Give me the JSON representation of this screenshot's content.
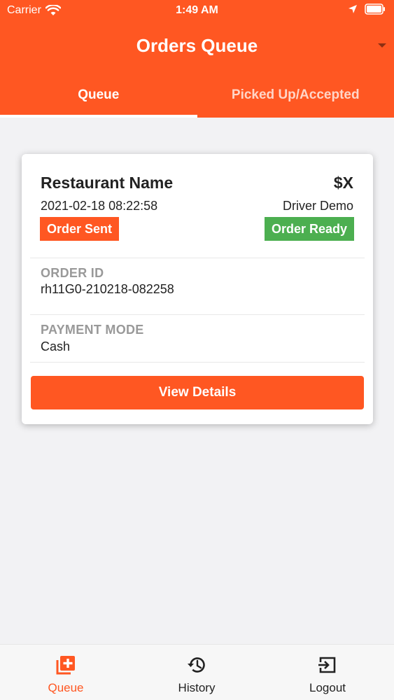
{
  "status": {
    "carrier": "Carrier",
    "time": "1:49 AM"
  },
  "header": {
    "title": "Orders Queue"
  },
  "tabs": [
    {
      "label": "Queue",
      "active": true
    },
    {
      "label": "Picked Up/Accepted",
      "active": false
    }
  ],
  "order": {
    "restaurant": "Restaurant Name",
    "price": "$X",
    "datetime": "2021-02-18 08:22:58",
    "driver": "Driver Demo",
    "status_sent": "Order Sent",
    "status_ready": "Order Ready",
    "order_id_label": "ORDER ID",
    "order_id": "rh11G0-210218-082258",
    "payment_label": "PAYMENT MODE",
    "payment": "Cash",
    "view_details": "View Details"
  },
  "nav": {
    "queue": "Queue",
    "history": "History",
    "logout": "Logout"
  },
  "colors": {
    "brand": "#ff5722",
    "ready": "#4caf50"
  }
}
